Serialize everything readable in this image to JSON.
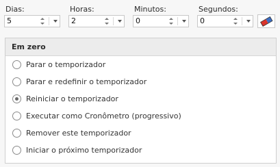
{
  "fields": {
    "days": {
      "label": "Dias:",
      "value": "5"
    },
    "hours": {
      "label": "Horas:",
      "value": "2"
    },
    "minutes": {
      "label": "Minutos:",
      "value": "0"
    },
    "seconds": {
      "label": "Segundos:",
      "value": "0"
    }
  },
  "clear_button": {
    "icon": "eraser-icon"
  },
  "group": {
    "title": "Em zero",
    "options": [
      {
        "label": "Parar o temporizador",
        "checked": false
      },
      {
        "label": "Parar e redefinir o temporizador",
        "checked": false
      },
      {
        "label": "Reiniciar o temporizador",
        "checked": true
      },
      {
        "label": "Executar como Cronômetro (progressivo)",
        "checked": false
      },
      {
        "label": "Remover este temporizador",
        "checked": false
      },
      {
        "label": "Iniciar o próximo temporizador",
        "checked": false
      }
    ]
  }
}
